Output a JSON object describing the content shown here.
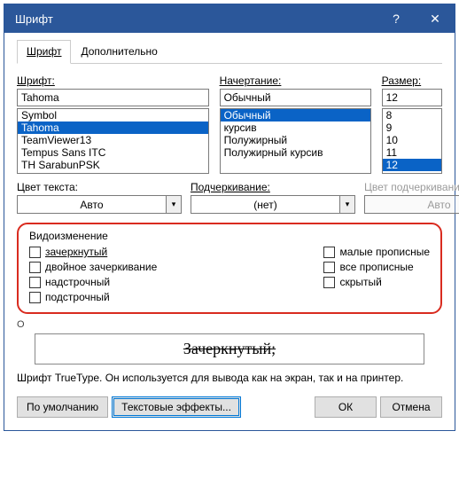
{
  "title": "Шрифт",
  "titlebar": {
    "help": "?",
    "close": "✕"
  },
  "tabs": {
    "font": "Шрифт",
    "advanced": "Дополнительно"
  },
  "font": {
    "label": "Шрифт:",
    "value": "Tahoma",
    "items": [
      "Symbol",
      "Tahoma",
      "TeamViewer13",
      "Tempus Sans ITC",
      "TH SarabunPSK"
    ],
    "selected": "Tahoma"
  },
  "style": {
    "label": "Начертание:",
    "value": "Обычный",
    "items": [
      "Обычный",
      "курсив",
      "Полужирный",
      "Полужирный курсив"
    ],
    "selected": "Обычный"
  },
  "size": {
    "label": "Размер:",
    "value": "12",
    "items": [
      "8",
      "9",
      "10",
      "11",
      "12"
    ],
    "selected": "12"
  },
  "color": {
    "label": "Цвет текста:",
    "value": "Авто"
  },
  "underline": {
    "label": "Подчеркивание:",
    "value": "(нет)"
  },
  "undercolor": {
    "label": "Цвет подчеркивания:",
    "value": "Авто"
  },
  "effects": {
    "legend": "Видоизменение",
    "strike": "зачеркнутый",
    "dstrike": "двойное зачеркивание",
    "super": "надстрочный",
    "sub": "подстрочный",
    "smallcaps": "малые прописные",
    "allcaps": "все прописные",
    "hidden": "скрытый"
  },
  "preview_cut": "О",
  "preview": "Зачеркнутый;",
  "hint": "Шрифт TrueType. Он используется для вывода как на экран, так и на принтер.",
  "buttons": {
    "default": "По умолчанию",
    "texteff": "Текстовые эффекты...",
    "ok": "ОК",
    "cancel": "Отмена"
  }
}
